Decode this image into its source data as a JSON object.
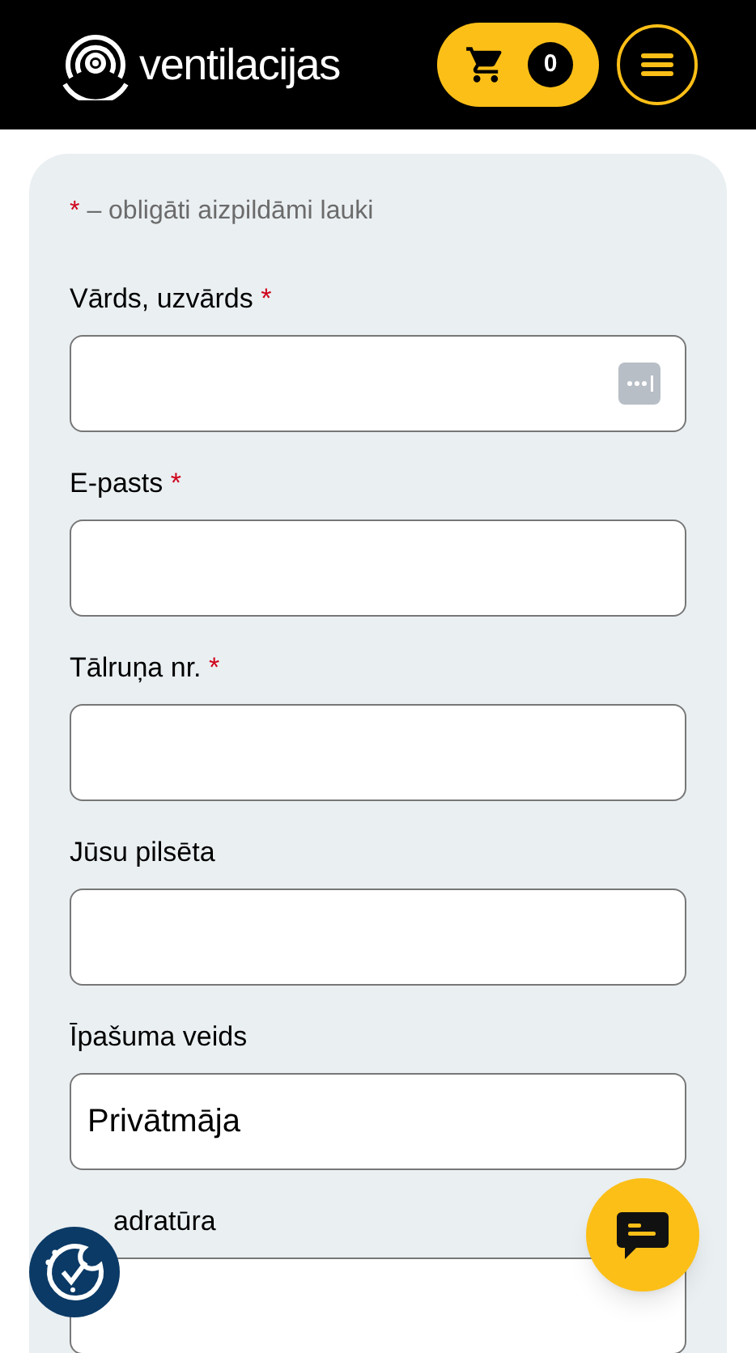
{
  "header": {
    "logo_text": "ventilacijas",
    "cart_count": "0"
  },
  "form": {
    "required_note_mark": "*",
    "required_note": "– obligāti aizpildāmi lauki",
    "fields": [
      {
        "label": "Vārds, uzvārds",
        "required": true,
        "autofill_icon": true
      },
      {
        "label": "E-pasts",
        "required": true,
        "autofill_icon": false
      },
      {
        "label": "Tālruņa nr.",
        "required": true,
        "autofill_icon": false
      },
      {
        "label": "Jūsu pilsēta",
        "required": false,
        "autofill_icon": false
      },
      {
        "label": "Īpašuma veids",
        "required": false,
        "value": "Privātmāja",
        "autofill_icon": false
      },
      {
        "label": "adratūra",
        "required": false,
        "autofill_icon": false
      }
    ]
  }
}
